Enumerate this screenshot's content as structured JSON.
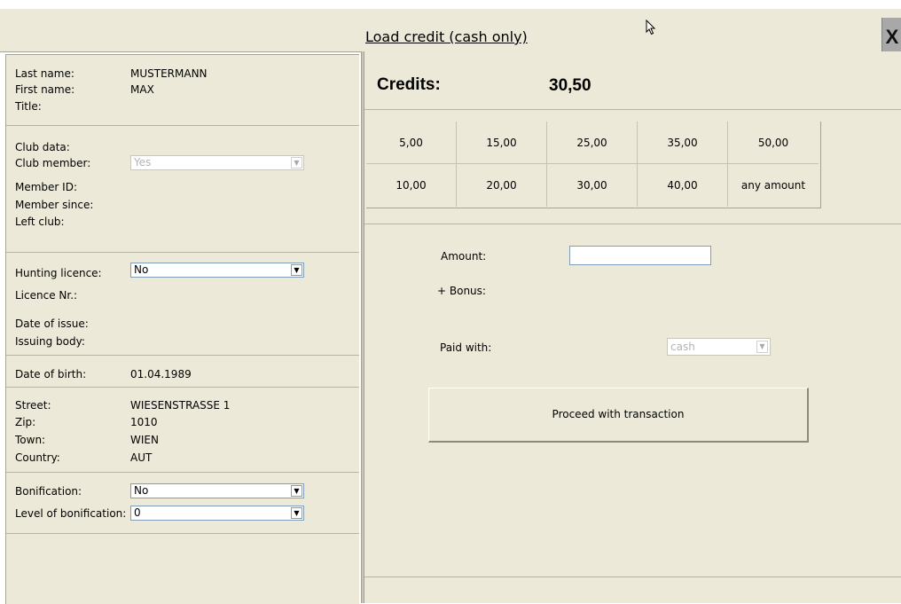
{
  "window": {
    "title": "Load credit (cash only)",
    "close_label": "X"
  },
  "person": {
    "last_name_label": "Last name:",
    "last_name": "MUSTERMANN",
    "first_name_label": "First name:",
    "first_name": "MAX",
    "title_label": "Title:"
  },
  "club": {
    "club_data_label": "Club data:",
    "club_member_label": "Club member:",
    "club_member_value": "Yes",
    "member_id_label": "Member ID:",
    "member_since_label": "Member since:",
    "left_club_label": "Left club:"
  },
  "hunting": {
    "licence_label": "Hunting licence:",
    "licence_value": "No",
    "licence_nr_label": "Licence Nr.:",
    "date_issue_label": "Date of issue:",
    "issuing_body_label": "Issuing body:"
  },
  "birth": {
    "label": "Date of birth:",
    "value": "01.04.1989"
  },
  "address": {
    "street_label": "Street:",
    "street": "WIESENSTRASSE 1",
    "zip_label": "Zip:",
    "zip": "1010",
    "town_label": "Town:",
    "town": "WIEN",
    "country_label": "Country:",
    "country": "AUT"
  },
  "bonification": {
    "label": "Bonification:",
    "value": "No",
    "level_label": "Level of bonification:",
    "level_value": "0"
  },
  "credits": {
    "label": "Credits:",
    "value": "30,50"
  },
  "amounts": {
    "row1": [
      "5,00",
      "15,00",
      "25,00",
      "35,00",
      "50,00"
    ],
    "row2": [
      "10,00",
      "20,00",
      "30,00",
      "40,00",
      "any amount"
    ]
  },
  "form": {
    "amount_label": "Amount:",
    "amount_value": "",
    "bonus_label": "+ Bonus:",
    "paid_with_label": "Paid with:",
    "paid_with_value": "cash",
    "proceed_label": "Proceed with transaction"
  }
}
